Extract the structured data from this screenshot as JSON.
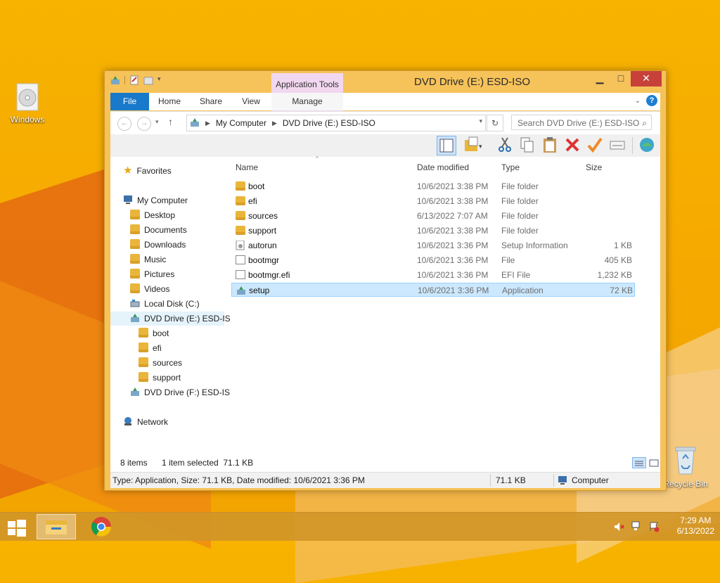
{
  "desktop": {
    "icons": [
      {
        "label": "Windows",
        "icon": "disc-icon"
      },
      {
        "label": "Recycle Bin",
        "icon": "recycle-bin-icon"
      }
    ]
  },
  "window": {
    "title": "DVD Drive (E:) ESD-ISO",
    "context_tab_group": "Application Tools",
    "tabs": [
      "File",
      "Home",
      "Share",
      "View",
      "Manage"
    ],
    "controls": {
      "minimize": "▁",
      "maximize": "□",
      "close": "✕"
    },
    "help_label": "?",
    "address": {
      "segments": [
        "My Computer",
        "DVD Drive (E:) ESD-ISO"
      ],
      "search_placeholder": "Search DVD Drive (E:) ESD-ISO"
    },
    "nav": {
      "favorites": "Favorites",
      "computer": "My Computer",
      "computer_children": [
        "Desktop",
        "Documents",
        "Downloads",
        "Music",
        "Pictures",
        "Videos",
        "Local Disk (C:)",
        "DVD Drive (E:) ESD-IS"
      ],
      "drive_e_children": [
        "boot",
        "efi",
        "sources",
        "support"
      ],
      "drive_f": "DVD Drive (F:) ESD-IS",
      "network": "Network"
    },
    "columns": {
      "name": "Name",
      "date": "Date modified",
      "type": "Type",
      "size": "Size"
    },
    "files": [
      {
        "name": "boot",
        "date": "10/6/2021 3:38 PM",
        "type": "File folder",
        "size": "",
        "kind": "folder"
      },
      {
        "name": "efi",
        "date": "10/6/2021 3:38 PM",
        "type": "File folder",
        "size": "",
        "kind": "folder"
      },
      {
        "name": "sources",
        "date": "6/13/2022 7:07 AM",
        "type": "File folder",
        "size": "",
        "kind": "folder"
      },
      {
        "name": "support",
        "date": "10/6/2021 3:38 PM",
        "type": "File folder",
        "size": "",
        "kind": "folder"
      },
      {
        "name": "autorun",
        "date": "10/6/2021 3:36 PM",
        "type": "Setup Information",
        "size": "1 KB",
        "kind": "inf"
      },
      {
        "name": "bootmgr",
        "date": "10/6/2021 3:36 PM",
        "type": "File",
        "size": "405 KB",
        "kind": "file"
      },
      {
        "name": "bootmgr.efi",
        "date": "10/6/2021 3:36 PM",
        "type": "EFI File",
        "size": "1,232 KB",
        "kind": "file"
      },
      {
        "name": "setup",
        "date": "10/6/2021 3:36 PM",
        "type": "Application",
        "size": "72 KB",
        "kind": "app",
        "selected": true
      }
    ],
    "status": {
      "items": "8 items",
      "selected": "1 item selected  71.1 KB"
    },
    "details": {
      "text": "Type: Application, Size: 71.1 KB, Date modified: 10/6/2021 3:36 PM",
      "size": "71.1 KB",
      "location": "Computer"
    }
  },
  "taskbar": {
    "time": "7:29 AM",
    "date": "6/13/2022"
  },
  "colors": {
    "accent": "#1979ca",
    "selection": "#cce8ff",
    "close": "#c7413a",
    "context_tab": "#f1d7ef"
  }
}
